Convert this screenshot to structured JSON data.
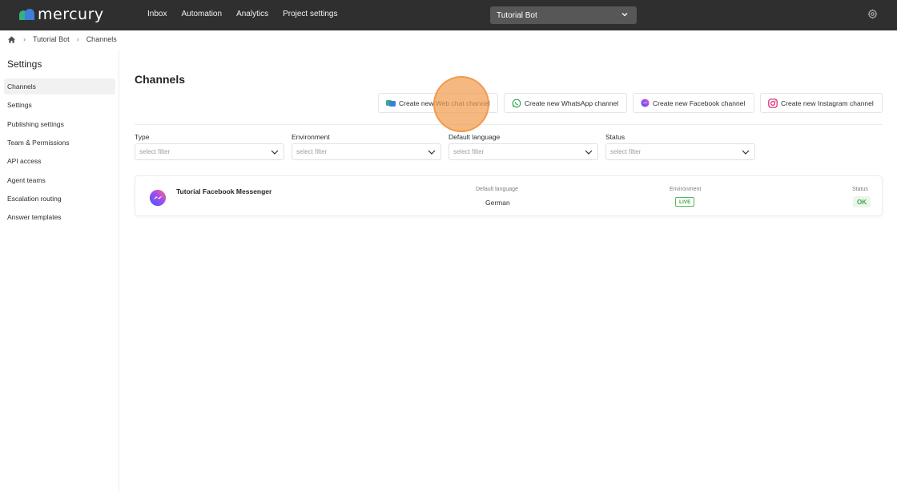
{
  "brand": {
    "name": "mercury"
  },
  "nav": {
    "items": [
      "Inbox",
      "Automation",
      "Analytics",
      "Project settings"
    ]
  },
  "bot_select": {
    "value": "Tutorial Bot"
  },
  "breadcrumb": {
    "items": [
      "Tutorial Bot",
      "Channels"
    ]
  },
  "sidebar": {
    "title": "Settings",
    "items": [
      "Channels",
      "Settings",
      "Publishing settings",
      "Team & Permissions",
      "API access",
      "Agent teams",
      "Escalation routing",
      "Answer templates"
    ],
    "active_index": 0
  },
  "main": {
    "title": "Channels",
    "buttons": [
      "Create new Web chat channel",
      "Create new WhatsApp channel",
      "Create new Facebook channel",
      "Create new Instagram channel"
    ],
    "filters": [
      {
        "label": "Type",
        "placeholder": "select filter"
      },
      {
        "label": "Environment",
        "placeholder": "select filter"
      },
      {
        "label": "Default language",
        "placeholder": "select filter"
      },
      {
        "label": "Status",
        "placeholder": "select filter"
      }
    ],
    "channels": [
      {
        "name": "Tutorial Facebook Messenger",
        "default_language_label": "Default language",
        "default_language": "German",
        "environment_label": "Environment",
        "environment": "LIVE",
        "status_label": "Status",
        "status": "OK"
      }
    ]
  },
  "colors": {
    "topbar": "#2f2f2f",
    "live": "#3ea848",
    "highlight": "#f39c50"
  }
}
